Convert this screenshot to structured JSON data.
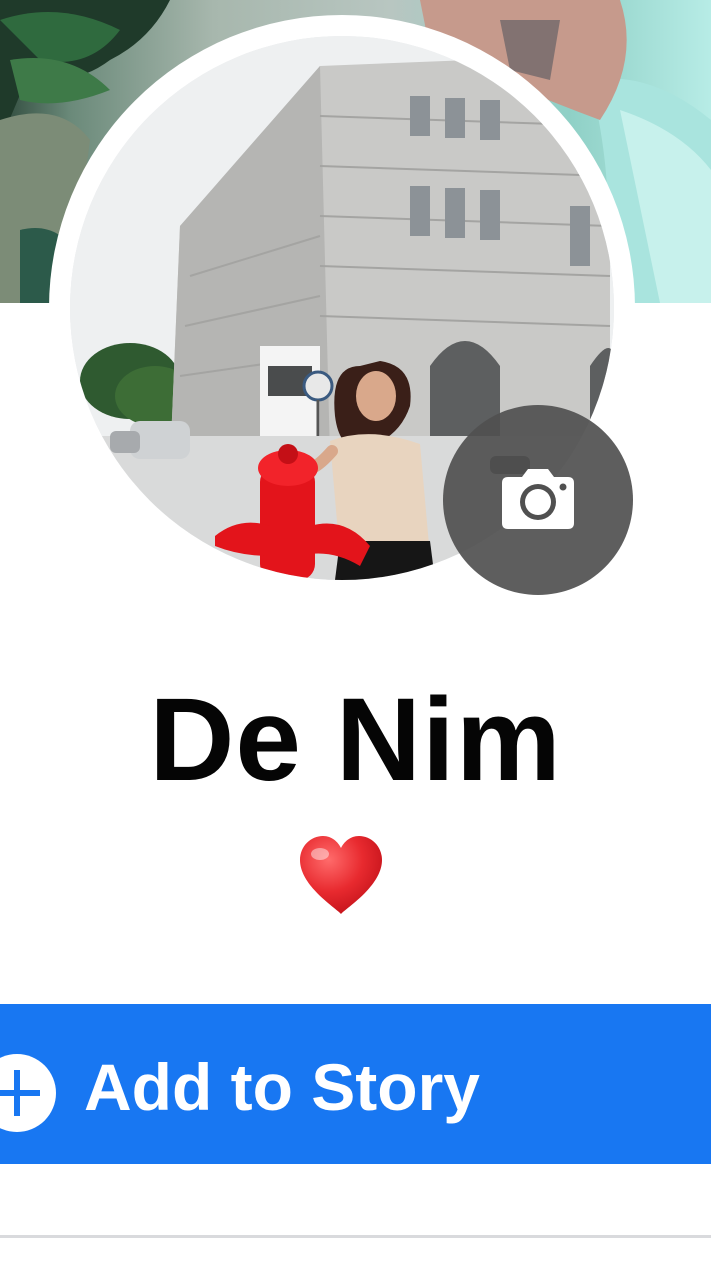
{
  "profile": {
    "name": "De Nim",
    "bio_emoji": "heart"
  },
  "actions": {
    "add_to_story_label": "Add to Story"
  },
  "icons": {
    "camera": "camera-icon",
    "add": "plus-circle-icon"
  },
  "colors": {
    "primary": "#1877f2",
    "camera_button_bg": "#505050",
    "heart": "#e0262c",
    "divider": "#d9dadd"
  }
}
